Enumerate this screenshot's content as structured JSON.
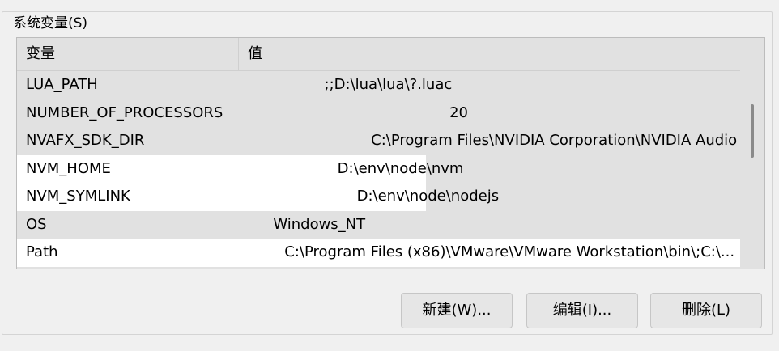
{
  "group_title": "系统变量(S)",
  "columns": {
    "variable": "变量",
    "value": "值"
  },
  "rows": [
    {
      "name": "LUA_PATH",
      "value": ";;D:\\lua\\lua\\?.luac",
      "highlight": "none"
    },
    {
      "name": "NUMBER_OF_PROCESSORS",
      "value": "20",
      "highlight": "none"
    },
    {
      "name": "NVAFX_SDK_DIR",
      "value": "C:\\Program Files\\NVIDIA Corporation\\NVIDIA Audio Effects ...",
      "highlight": "none"
    },
    {
      "name": "NVM_HOME",
      "value": "D:\\env\\node\\nvm",
      "highlight": "partial"
    },
    {
      "name": "NVM_SYMLINK",
      "value": "D:\\env\\node\\nodejs",
      "highlight": "partial"
    },
    {
      "name": "OS",
      "value": "Windows_NT",
      "highlight": "none"
    },
    {
      "name": "Path",
      "value": "C:\\Program Files (x86)\\VMware\\VMware Workstation\\bin\\;C:\\...",
      "highlight": "full"
    }
  ],
  "buttons": {
    "new": "新建(W)...",
    "edit": "编辑(I)...",
    "delete": "删除(L)"
  },
  "colors": {
    "background": "#f0f0f0",
    "list_background": "#e1e1e1",
    "highlight": "#ffffff"
  }
}
